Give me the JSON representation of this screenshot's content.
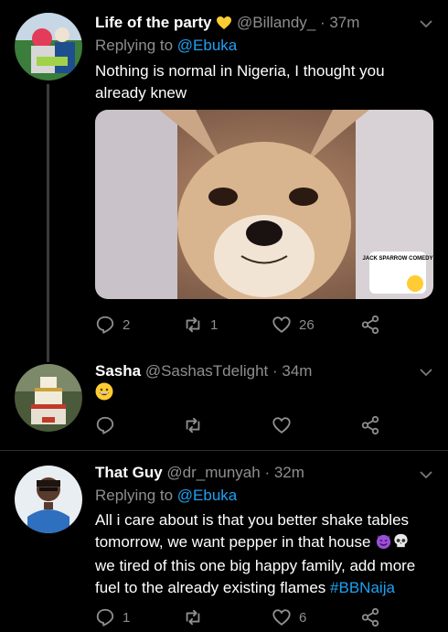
{
  "tweets": [
    {
      "name": "Life of the party",
      "name_emoji": "yellow-heart",
      "handle": "@Billandy_",
      "time": "· 37m",
      "replying_prefix": "Replying to",
      "replying_to": "@Ebuka",
      "text": "Nothing is normal in Nigeria, I thought you already knew",
      "media_watermark": "JACK SPARROW COMEDY",
      "reply_count": "2",
      "retweet_count": "1",
      "like_count": "26"
    },
    {
      "name": "Sasha",
      "handle": "@SashasTdelight",
      "time": "· 34m",
      "text_emoji": "grinning-face"
    },
    {
      "name": "That Guy",
      "handle": "@dr_munyah",
      "time": "· 32m",
      "replying_prefix": "Replying to",
      "replying_to": "@Ebuka",
      "text_line1": "All i care about is that you better shake tables",
      "text_line2a": "tomorrow, we want pepper in that house",
      "text_line2_emojis": [
        "smiling-devil",
        "skull"
      ],
      "text_line3": "we tired of this one big happy family, add more",
      "text_line4": "fuel to the already existing flames",
      "hashtag": "#BBNaija",
      "reply_count": "1",
      "like_count": "6"
    }
  ],
  "colors": {
    "background": "#000000",
    "accent": "#1da1f2",
    "muted": "#8e8e8e",
    "divider": "#2f2f2f"
  }
}
